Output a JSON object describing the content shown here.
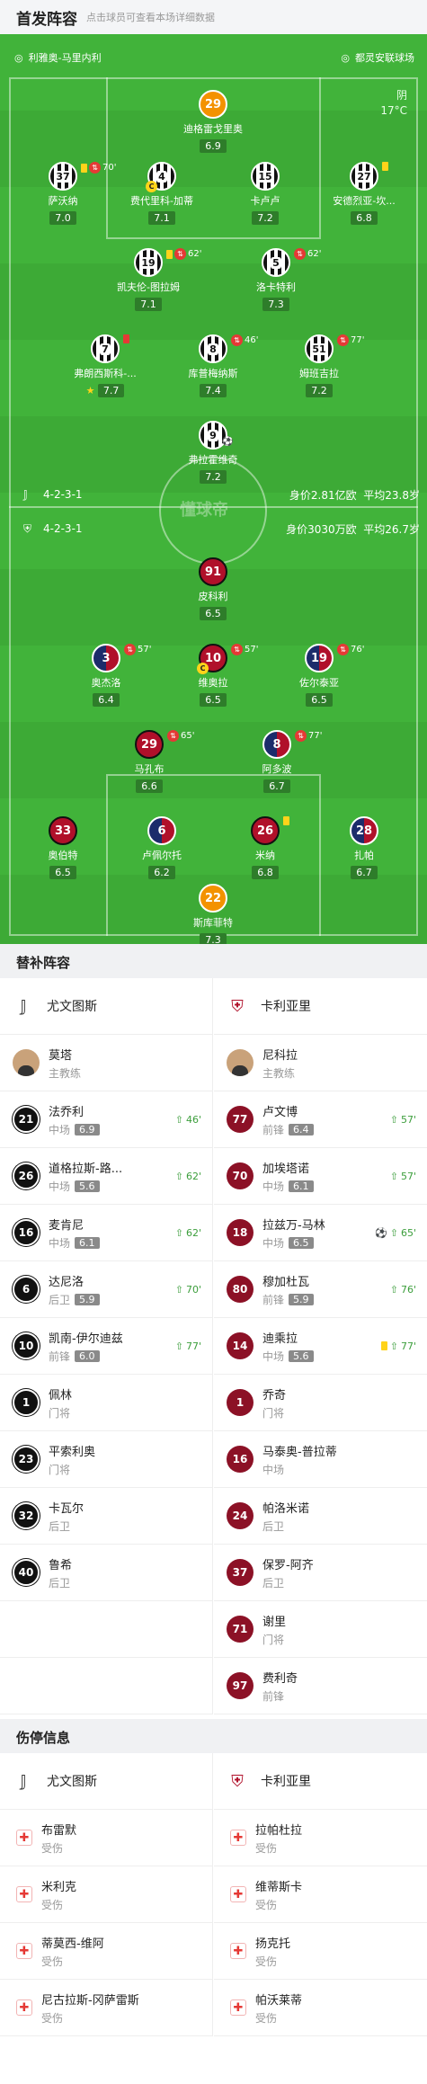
{
  "header": {
    "title": "首发阵容",
    "subtitle": "点击球员可查看本场详细数据"
  },
  "pitch": {
    "home_venue": "利雅奥-马里内利",
    "away_venue": "都灵安联球场",
    "weather": "阴",
    "temperature": "17°C",
    "watermark": "懂球帝",
    "juventus_formation": "4-2-3-1",
    "juventus_value": "身价2.81亿欧",
    "juventus_age": "平均23.8岁",
    "cagliari_formation": "4-2-3-1",
    "cagliari_value": "身价3030万欧",
    "cagliari_age": "平均26.7岁"
  },
  "juventus_players": [
    {
      "num": "29",
      "name": "迪格雷戈里奥",
      "rating": "6.9"
    },
    {
      "num": "37",
      "name": "萨沃纳",
      "rating": "7.0",
      "sub": "70'"
    },
    {
      "num": "4",
      "name": "费代里科-加蒂",
      "rating": "7.1"
    },
    {
      "num": "15",
      "name": "卡卢卢",
      "rating": "7.2"
    },
    {
      "num": "27",
      "name": "安德烈亚-坎...",
      "rating": "6.8"
    },
    {
      "num": "19",
      "name": "凯夫伦-图拉姆",
      "rating": "7.1",
      "sub": "62'"
    },
    {
      "num": "5",
      "name": "洛卡特利",
      "rating": "7.3",
      "sub": "62'"
    },
    {
      "num": "7",
      "name": "弗朗西斯科-...",
      "rating": "7.7"
    },
    {
      "num": "8",
      "name": "库普梅纳斯",
      "rating": "7.4",
      "sub": "46'"
    },
    {
      "num": "51",
      "name": "姆班吉拉",
      "rating": "7.2",
      "sub": "77'"
    },
    {
      "num": "9",
      "name": "弗拉霍维奇",
      "rating": "7.2"
    }
  ],
  "cagliari_players": [
    {
      "num": "91",
      "name": "皮科利",
      "rating": "6.5"
    },
    {
      "num": "3",
      "name": "奥杰洛",
      "rating": "6.4",
      "sub": "57'"
    },
    {
      "num": "10",
      "name": "维奥拉",
      "rating": "6.5",
      "sub": "57'"
    },
    {
      "num": "19",
      "name": "佐尔泰亚",
      "rating": "6.5",
      "sub": "76'"
    },
    {
      "num": "29",
      "name": "马孔布",
      "rating": "6.6",
      "sub": "65'"
    },
    {
      "num": "8",
      "name": "阿多波",
      "rating": "6.7",
      "sub": "77'"
    },
    {
      "num": "33",
      "name": "奥伯特",
      "rating": "6.5"
    },
    {
      "num": "6",
      "name": "卢佩尔托",
      "rating": "6.2"
    },
    {
      "num": "26",
      "name": "米纳",
      "rating": "6.8"
    },
    {
      "num": "28",
      "name": "扎帕",
      "rating": "6.7"
    },
    {
      "num": "22",
      "name": "斯库菲特",
      "rating": "7.3"
    }
  ],
  "subs": {
    "title": "替补阵容",
    "home_team": "尤文图斯",
    "away_team": "卡利亚里",
    "home_coach": {
      "name": "莫塔",
      "role": "主教练"
    },
    "away_coach": {
      "name": "尼科拉",
      "role": "主教练"
    },
    "home": [
      {
        "num": "21",
        "name": "法乔利",
        "pos": "中场",
        "rating": "6.9",
        "min": "46'"
      },
      {
        "num": "26",
        "name": "道格拉斯-路...",
        "pos": "中场",
        "rating": "5.6",
        "min": "62'"
      },
      {
        "num": "16",
        "name": "麦肯尼",
        "pos": "中场",
        "rating": "6.1",
        "min": "62'"
      },
      {
        "num": "6",
        "name": "达尼洛",
        "pos": "后卫",
        "rating": "5.9",
        "min": "70'"
      },
      {
        "num": "10",
        "name": "凯南-伊尔迪兹",
        "pos": "前锋",
        "rating": "6.0",
        "min": "77'"
      },
      {
        "num": "1",
        "name": "佩林",
        "pos": "门将"
      },
      {
        "num": "23",
        "name": "平索利奥",
        "pos": "门将"
      },
      {
        "num": "32",
        "name": "卡瓦尔",
        "pos": "后卫"
      },
      {
        "num": "40",
        "name": "鲁希",
        "pos": "后卫"
      }
    ],
    "away": [
      {
        "num": "77",
        "name": "卢文博",
        "pos": "前锋",
        "rating": "6.4",
        "min": "57'"
      },
      {
        "num": "70",
        "name": "加埃塔诺",
        "pos": "中场",
        "rating": "6.1",
        "min": "57'"
      },
      {
        "num": "18",
        "name": "拉兹万-马林",
        "pos": "中场",
        "rating": "6.5",
        "min": "65'"
      },
      {
        "num": "80",
        "name": "穆加杜瓦",
        "pos": "前锋",
        "rating": "5.9",
        "min": "76'"
      },
      {
        "num": "14",
        "name": "迪乘拉",
        "pos": "中场",
        "rating": "5.6",
        "min": "77'"
      },
      {
        "num": "1",
        "name": "乔奇",
        "pos": "门将"
      },
      {
        "num": "16",
        "name": "马泰奥-普拉蒂",
        "pos": "中场"
      },
      {
        "num": "24",
        "name": "帕洛米诺",
        "pos": "后卫"
      },
      {
        "num": "37",
        "name": "保罗-阿齐",
        "pos": "后卫"
      },
      {
        "num": "71",
        "name": "谢里",
        "pos": "门将"
      },
      {
        "num": "97",
        "name": "费利奇",
        "pos": "前锋"
      }
    ]
  },
  "injuries": {
    "title": "伤停信息",
    "home_team": "尤文图斯",
    "away_team": "卡利亚里",
    "home": [
      {
        "name": "布雷默",
        "status": "受伤"
      },
      {
        "name": "米利克",
        "status": "受伤"
      },
      {
        "name": "蒂莫西-维阿",
        "status": "受伤"
      },
      {
        "name": "尼古拉斯-冈萨雷斯",
        "status": "受伤"
      }
    ],
    "away": [
      {
        "name": "拉帕杜拉",
        "status": "受伤"
      },
      {
        "name": "维蒂斯卡",
        "status": "受伤"
      },
      {
        "name": "扬克托",
        "status": "受伤"
      },
      {
        "name": "帕沃莱蒂",
        "status": "受伤"
      }
    ]
  }
}
